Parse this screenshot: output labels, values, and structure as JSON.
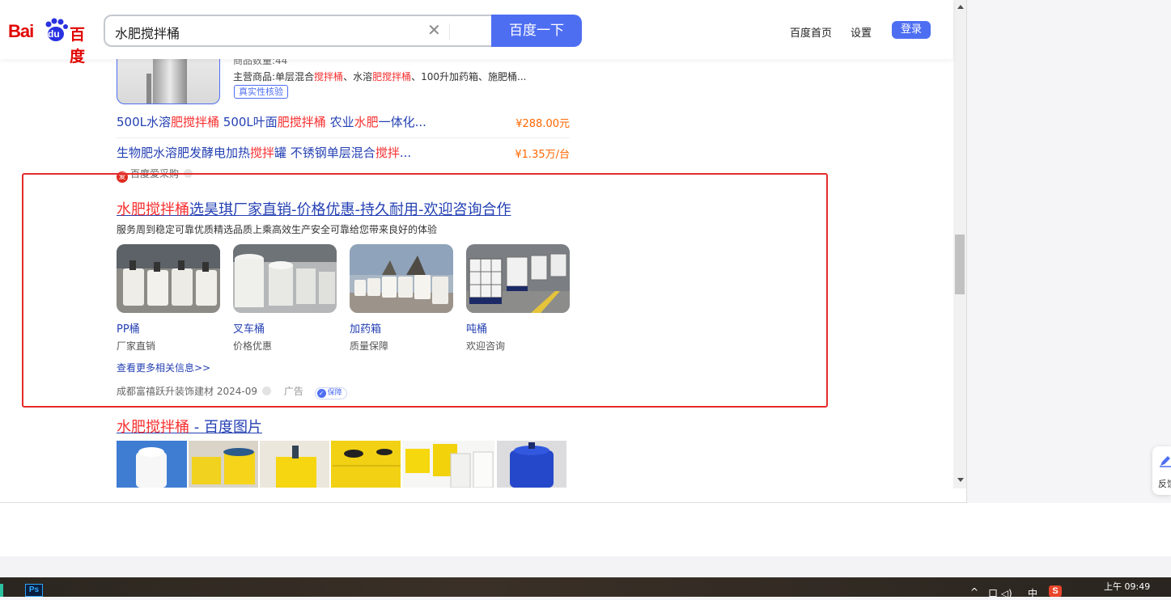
{
  "header": {
    "search_query": "水肥搅拌桶",
    "search_button": "百度一下",
    "logo_text_en": "Bai",
    "logo_text_du": "du",
    "logo_text_cn": "百度",
    "nav_home": "百度首页",
    "nav_settings": "设置",
    "login": "登录"
  },
  "shop": {
    "line_partial": "商品数量:44",
    "main_products_prefix": "主营商品:单层混合",
    "main_products_hl1": "搅拌桶",
    "main_products_mid": "、水溶",
    "main_products_hl2": "肥搅拌桶",
    "main_products_suffix": "、100升加药箱、施肥桶...",
    "verify_tag": "真实性核验",
    "offers": [
      {
        "t1": "500L水溶",
        "h1": "肥搅拌桶",
        "t2": " 500L叶面",
        "h2": "肥搅拌桶",
        "t3": " 农业",
        "h3": "水肥",
        "t4": "一体化...",
        "price": "¥288.00元"
      },
      {
        "t1": "生物肥水溶肥发酵电加热",
        "h1": "搅拌",
        "t2": "罐 不锈钢单层混合",
        "h2": "搅拌",
        "t3": "...",
        "h3": "",
        "t4": "",
        "price": "¥1.35万/台"
      }
    ],
    "source": "百度爱采购",
    "source_icon": "爱"
  },
  "ad": {
    "title_hl": "水肥搅拌桶",
    "title_rest": "选昊琪厂家直销-价格优惠-持久耐用-欢迎咨询合作",
    "description": "服务周到稳定可靠优质精选品质上乘高效生产安全可靠给您带来良好的体验",
    "tiles": [
      {
        "name": "PP桶",
        "sub": "厂家直销"
      },
      {
        "name": "叉车桶",
        "sub": "价格优惠"
      },
      {
        "name": "加药箱",
        "sub": "质量保障"
      },
      {
        "name": "吨桶",
        "sub": "欢迎咨询"
      }
    ],
    "more": "查看更多相关信息>>",
    "advertiser": "成都富禧跃升装饰建材",
    "date": "2024-09",
    "ad_label": "广告",
    "guarantee": "保障",
    "frame_color": "#e52b2b"
  },
  "images_result": {
    "title_hl": "水肥搅拌桶",
    "title_rest": " - 百度图片"
  },
  "side_widget": {
    "label": "反馈"
  },
  "taskbar": {
    "ps_label": "Ps",
    "tray_caret": "^",
    "tray_volume": "口 ◁)",
    "ime": "中",
    "sogou": "S",
    "clock": "上午 09:49"
  },
  "colors": {
    "brand": "#4e6ef2",
    "link": "#2440b3",
    "highlight": "#f73131",
    "price": "#ff6600"
  }
}
